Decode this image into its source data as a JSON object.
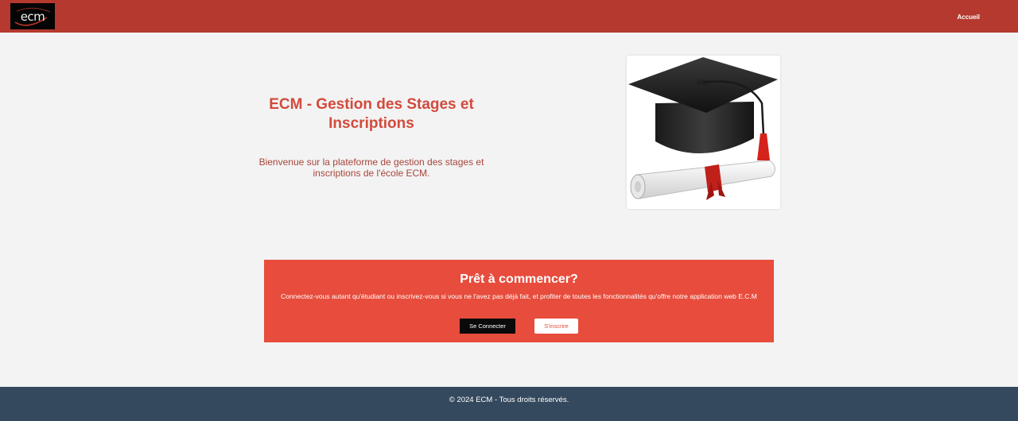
{
  "header": {
    "logo_text": "ecm",
    "nav_home": "Accueil"
  },
  "hero": {
    "title": "ECM - Gestion des Stages et Inscriptions",
    "description": "Bienvenue sur la plateforme de gestion des stages et inscriptions de l'école ECM."
  },
  "cta": {
    "title": "Prêt à commencer?",
    "text": "Connectez-vous autant qu'étudiant ou inscrivez-vous si vous ne l'avez pas déjà fait, et profiter de toutes les fonctionnalités qu'offre notre application web E.C.M",
    "login_label": "Se Connecter",
    "register_label": "S'inscrire"
  },
  "footer": {
    "copyright": "© 2024 ECM - Tous droits réservés."
  },
  "colors": {
    "header_bg": "#b5392e",
    "accent": "#e74c3c",
    "title": "#d24a3c",
    "footer_bg": "#34495e"
  },
  "icons": {
    "hero_image": "graduation-cap-diploma"
  }
}
